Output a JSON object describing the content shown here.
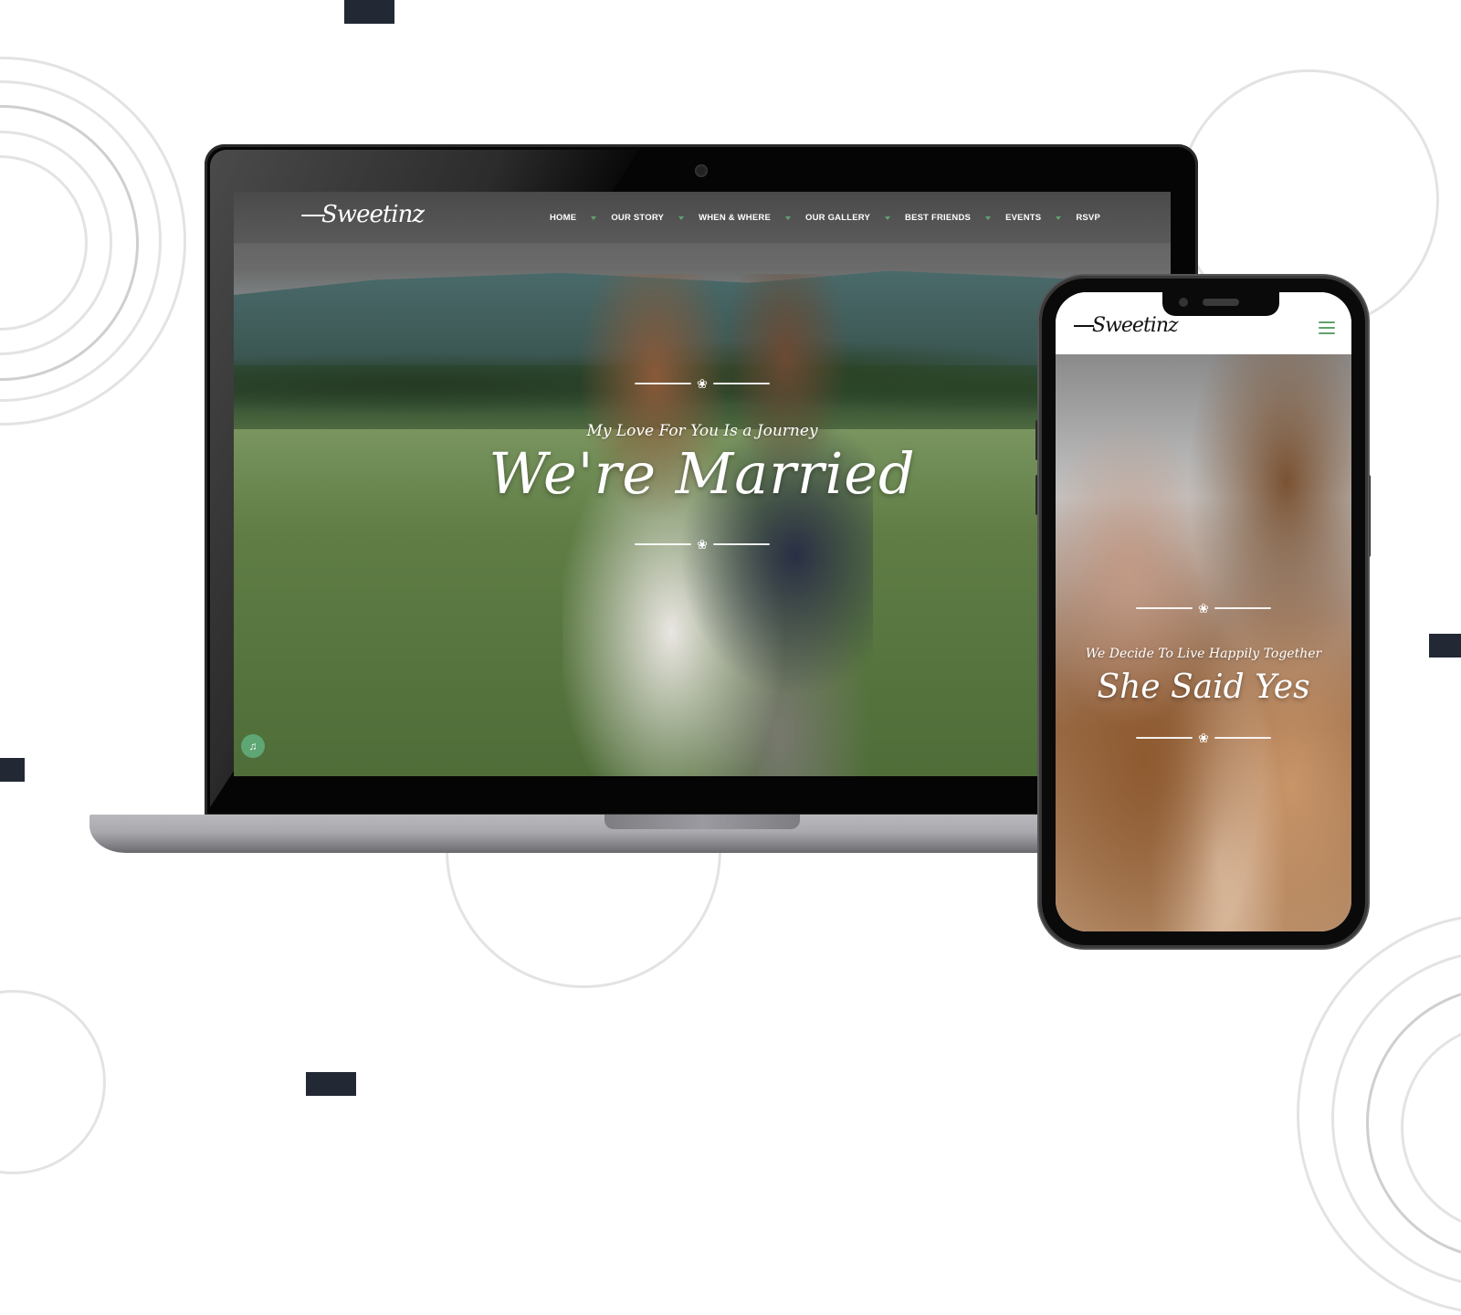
{
  "background": {
    "accent_square_color": "#222834",
    "ring_color": "#e3e3e3"
  },
  "desktop_site": {
    "logo": "Sweetinz",
    "nav": {
      "items": [
        {
          "label": "HOME"
        },
        {
          "label": "OUR STORY"
        },
        {
          "label": "WHEN & WHERE"
        },
        {
          "label": "OUR GALLERY"
        },
        {
          "label": "BEST FRIENDS"
        },
        {
          "label": "EVENTS"
        },
        {
          "label": "RSVP"
        }
      ],
      "separator_color": "#5fa36d"
    },
    "hero": {
      "subtitle": "My Love For You Is a Journey",
      "title": "We're Married",
      "flourish_icon": "❀"
    },
    "music_button": {
      "icon": "♫",
      "color": "#5fa675"
    }
  },
  "mobile_site": {
    "logo": "Sweetinz",
    "menu_icon_color": "#5fa36d",
    "hero": {
      "subtitle": "We Decide To Live Happily Together",
      "title": "She Said Yes",
      "flourish_icon": "❀"
    }
  }
}
